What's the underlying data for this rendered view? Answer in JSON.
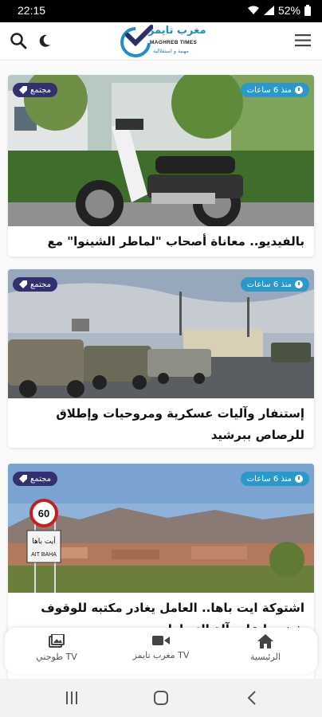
{
  "status": {
    "time": "22:15",
    "battery": "52%"
  },
  "header": {
    "logo_name": "مغرب تايمز",
    "logo_latin": "MAGHREB TIMES",
    "logo_tagline": "مهنية و استقلالية",
    "icons": [
      "search-icon",
      "moon-icon",
      "menu-icon"
    ]
  },
  "articles": [
    {
      "category": "مجتمع",
      "time": "منذ 6 ساعات",
      "title": "بالفيديو.. معاناة أصحاب \"لماطر الشينوا\" مع البوليس"
    },
    {
      "category": "مجتمع",
      "time": "منذ 6 ساعات",
      "title": "إستنفار وآليات عسكرية ومروحيات وإطلاق للرصاص ببرشيد"
    },
    {
      "category": "مجتمع",
      "time": "منذ 6 ساعات",
      "title": "اشتوكة ايت باها.. العامل يغادر مكتبه للوقوف شخصيا على آلة التسلط",
      "sign_text": "أيت باها",
      "sign_latin": "AIT BAHA",
      "speed": "60"
    }
  ],
  "bottom_nav": [
    {
      "label": "الرئيسية",
      "icon": "home-icon"
    },
    {
      "label": "مغرب تايمز TV",
      "icon": "video-camera-icon"
    },
    {
      "label": "طوجني TV",
      "icon": "gallery-icon"
    }
  ],
  "colors": {
    "accent": "#2a98c9",
    "category_badge": "#33306e"
  }
}
